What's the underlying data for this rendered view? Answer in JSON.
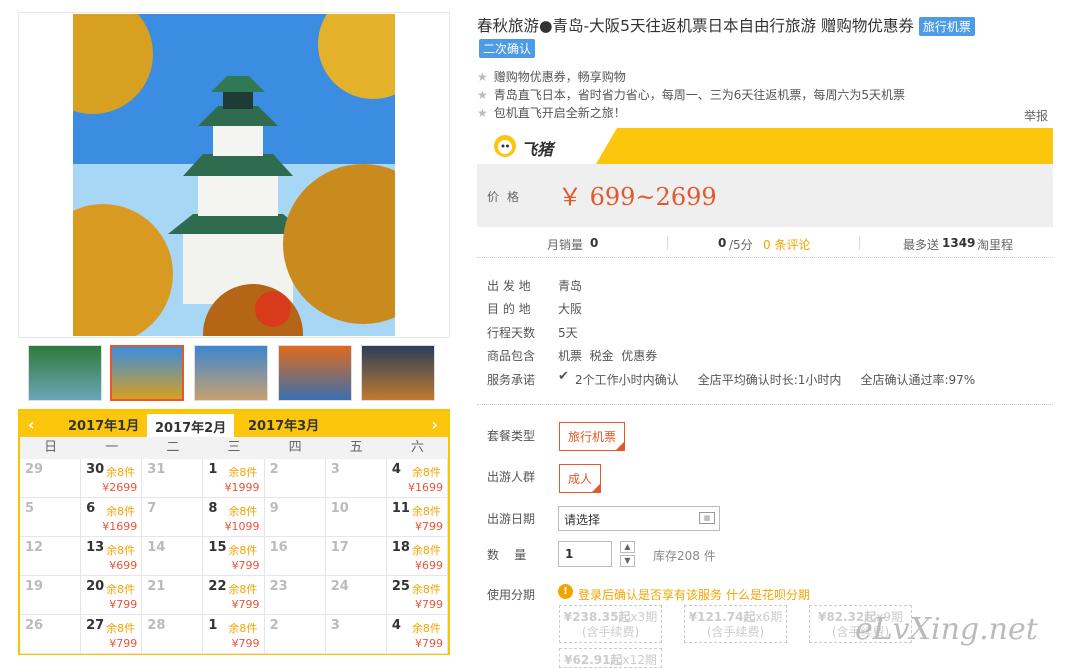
{
  "title": "春秋旅游●青岛-大阪5天往返机票日本自由行旅游 赠购物优惠券",
  "tags": {
    "category": "旅行机票",
    "confirm": "二次确认"
  },
  "features": [
    "赠购物优惠券，畅享购物",
    "青岛直飞日本，省时省力省心，每周一、三为6天往返机票，每周六为5天机票",
    "包机直飞开启全新之旅！"
  ],
  "report_label": "举报",
  "brand": {
    "name": "飞猪",
    "accent": "#fcc60c"
  },
  "price": {
    "label": "价格",
    "value": "￥ 699~2699"
  },
  "stats": {
    "monthly_sales_label": "月销量",
    "monthly_sales": "0",
    "rating": "0",
    "rating_suffix": "/5分",
    "reviews": "0 条评论",
    "mileage_prefix": "最多送",
    "mileage": "1349",
    "mileage_suffix": "淘里程"
  },
  "info": [
    {
      "label": "出 发 地",
      "value": "青岛"
    },
    {
      "label": "目 的 地",
      "value": "大阪"
    },
    {
      "label": "行程天数",
      "value": "5天"
    },
    {
      "label": "商品包含",
      "value": "机票  税金  优惠券"
    },
    {
      "label": "服务承诺",
      "value": "2个工作小时内确认     全店平均确认时长:1小时内     全店确认通过率:97%"
    }
  ],
  "options": {
    "package_label": "套餐类型",
    "package_value": "旅行机票",
    "people_label": "出游人群",
    "people_value": "成人",
    "date_label": "出游日期",
    "date_value": "请选择",
    "qty_label": "数    量",
    "qty_value": "1",
    "stock": "库存208 件",
    "installment_label": "使用分期",
    "installment_notice": "登录后确认是否享有该服务",
    "installment_link": "什么是花呗分期",
    "installment_plans": [
      {
        "amount": "¥238.35起",
        "period": "x3期",
        "note": "(含手续费)"
      },
      {
        "amount": "¥121.74起",
        "period": "x6期",
        "note": "(含手续费)"
      },
      {
        "amount": "¥82.32起",
        "period": "x9期",
        "note": "(含手续费)"
      },
      {
        "amount": "¥62.91起",
        "period": "x12期",
        "note": ""
      }
    ]
  },
  "calendar": {
    "months": [
      "2017年1月",
      "2017年2月",
      "2017年3月"
    ],
    "weekdays": [
      "日",
      "一",
      "二",
      "三",
      "四",
      "五",
      "六"
    ],
    "cells": [
      {
        "d": "29",
        "dim": true
      },
      {
        "d": "30",
        "s": "余8件",
        "p": "¥2699"
      },
      {
        "d": "31",
        "dim": true
      },
      {
        "d": "1",
        "s": "余8件",
        "p": "¥1999"
      },
      {
        "d": "2",
        "dim": true
      },
      {
        "d": "3",
        "dim": true
      },
      {
        "d": "4",
        "s": "余8件",
        "p": "¥1699"
      },
      {
        "d": "5",
        "dim": true
      },
      {
        "d": "6",
        "s": "余8件",
        "p": "¥1699"
      },
      {
        "d": "7",
        "dim": true
      },
      {
        "d": "8",
        "s": "余8件",
        "p": "¥1099"
      },
      {
        "d": "9",
        "dim": true
      },
      {
        "d": "10",
        "dim": true
      },
      {
        "d": "11",
        "s": "余8件",
        "p": "¥799"
      },
      {
        "d": "12",
        "dim": true
      },
      {
        "d": "13",
        "s": "余8件",
        "p": "¥699"
      },
      {
        "d": "14",
        "dim": true
      },
      {
        "d": "15",
        "s": "余8件",
        "p": "¥799"
      },
      {
        "d": "16",
        "dim": true
      },
      {
        "d": "17",
        "dim": true
      },
      {
        "d": "18",
        "s": "余8件",
        "p": "¥699"
      },
      {
        "d": "19",
        "dim": true
      },
      {
        "d": "20",
        "s": "余8件",
        "p": "¥799"
      },
      {
        "d": "21",
        "dim": true
      },
      {
        "d": "22",
        "s": "余8件",
        "p": "¥799"
      },
      {
        "d": "23",
        "dim": true
      },
      {
        "d": "24",
        "dim": true
      },
      {
        "d": "25",
        "s": "余8件",
        "p": "¥799"
      },
      {
        "d": "26",
        "dim": true
      },
      {
        "d": "27",
        "s": "余8件",
        "p": "¥799"
      },
      {
        "d": "28",
        "dim": true
      },
      {
        "d": "1",
        "s": "余8件",
        "p": "¥799"
      },
      {
        "d": "2",
        "dim": true
      },
      {
        "d": "3",
        "dim": true
      },
      {
        "d": "4",
        "s": "余8件",
        "p": "¥799"
      }
    ]
  },
  "watermark": "eLvXing.net"
}
